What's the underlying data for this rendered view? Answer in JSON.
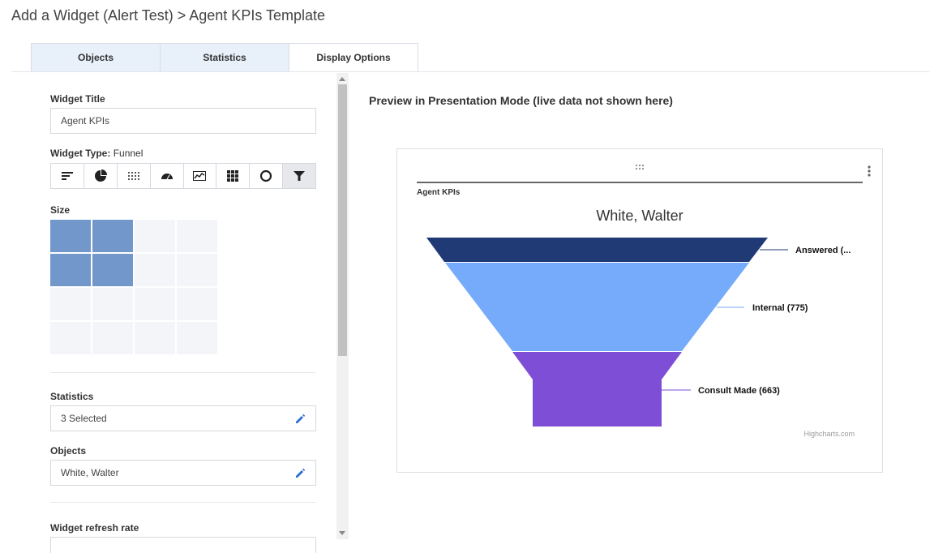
{
  "page": {
    "title": "Add a Widget (Alert Test) > Agent KPIs Template"
  },
  "tabs": [
    {
      "label": "Objects"
    },
    {
      "label": "Statistics"
    },
    {
      "label": "Display Options"
    }
  ],
  "form": {
    "widget_title_label": "Widget Title",
    "widget_title_value": "Agent KPIs",
    "widget_type_label": "Widget Type:",
    "widget_type_value": "Funnel",
    "widget_types": [
      "list",
      "pie",
      "dot-matrix",
      "gauge",
      "line",
      "grid",
      "donut",
      "funnel"
    ],
    "size_label": "Size",
    "size": {
      "cols_selected": 2,
      "rows_selected": 2,
      "cols_max": 4,
      "rows_max": 4
    },
    "statistics_label": "Statistics",
    "statistics_value": "3 Selected",
    "objects_label": "Objects",
    "objects_value": "White, Walter",
    "refresh_label": "Widget refresh rate"
  },
  "preview": {
    "heading": "Preview in Presentation Mode (live data not shown here)",
    "widget_name": "Agent KPIs",
    "credit": "Highcharts.com"
  },
  "chart_data": {
    "type": "funnel",
    "title": "White, Walter",
    "series": [
      {
        "name": "Answered",
        "label": "Answered (...",
        "value": null,
        "color": "#1f3a75"
      },
      {
        "name": "Internal",
        "label": "Internal (775)",
        "value": 775,
        "color": "#76aafa"
      },
      {
        "name": "Consult Made",
        "label": "Consult Made (663)",
        "value": 663,
        "color": "#7f4ed6"
      }
    ]
  },
  "colors": {
    "accent": "#2f6fd1",
    "size_selected": "#7297cb",
    "tab_inactive": "#e8f0fa"
  }
}
